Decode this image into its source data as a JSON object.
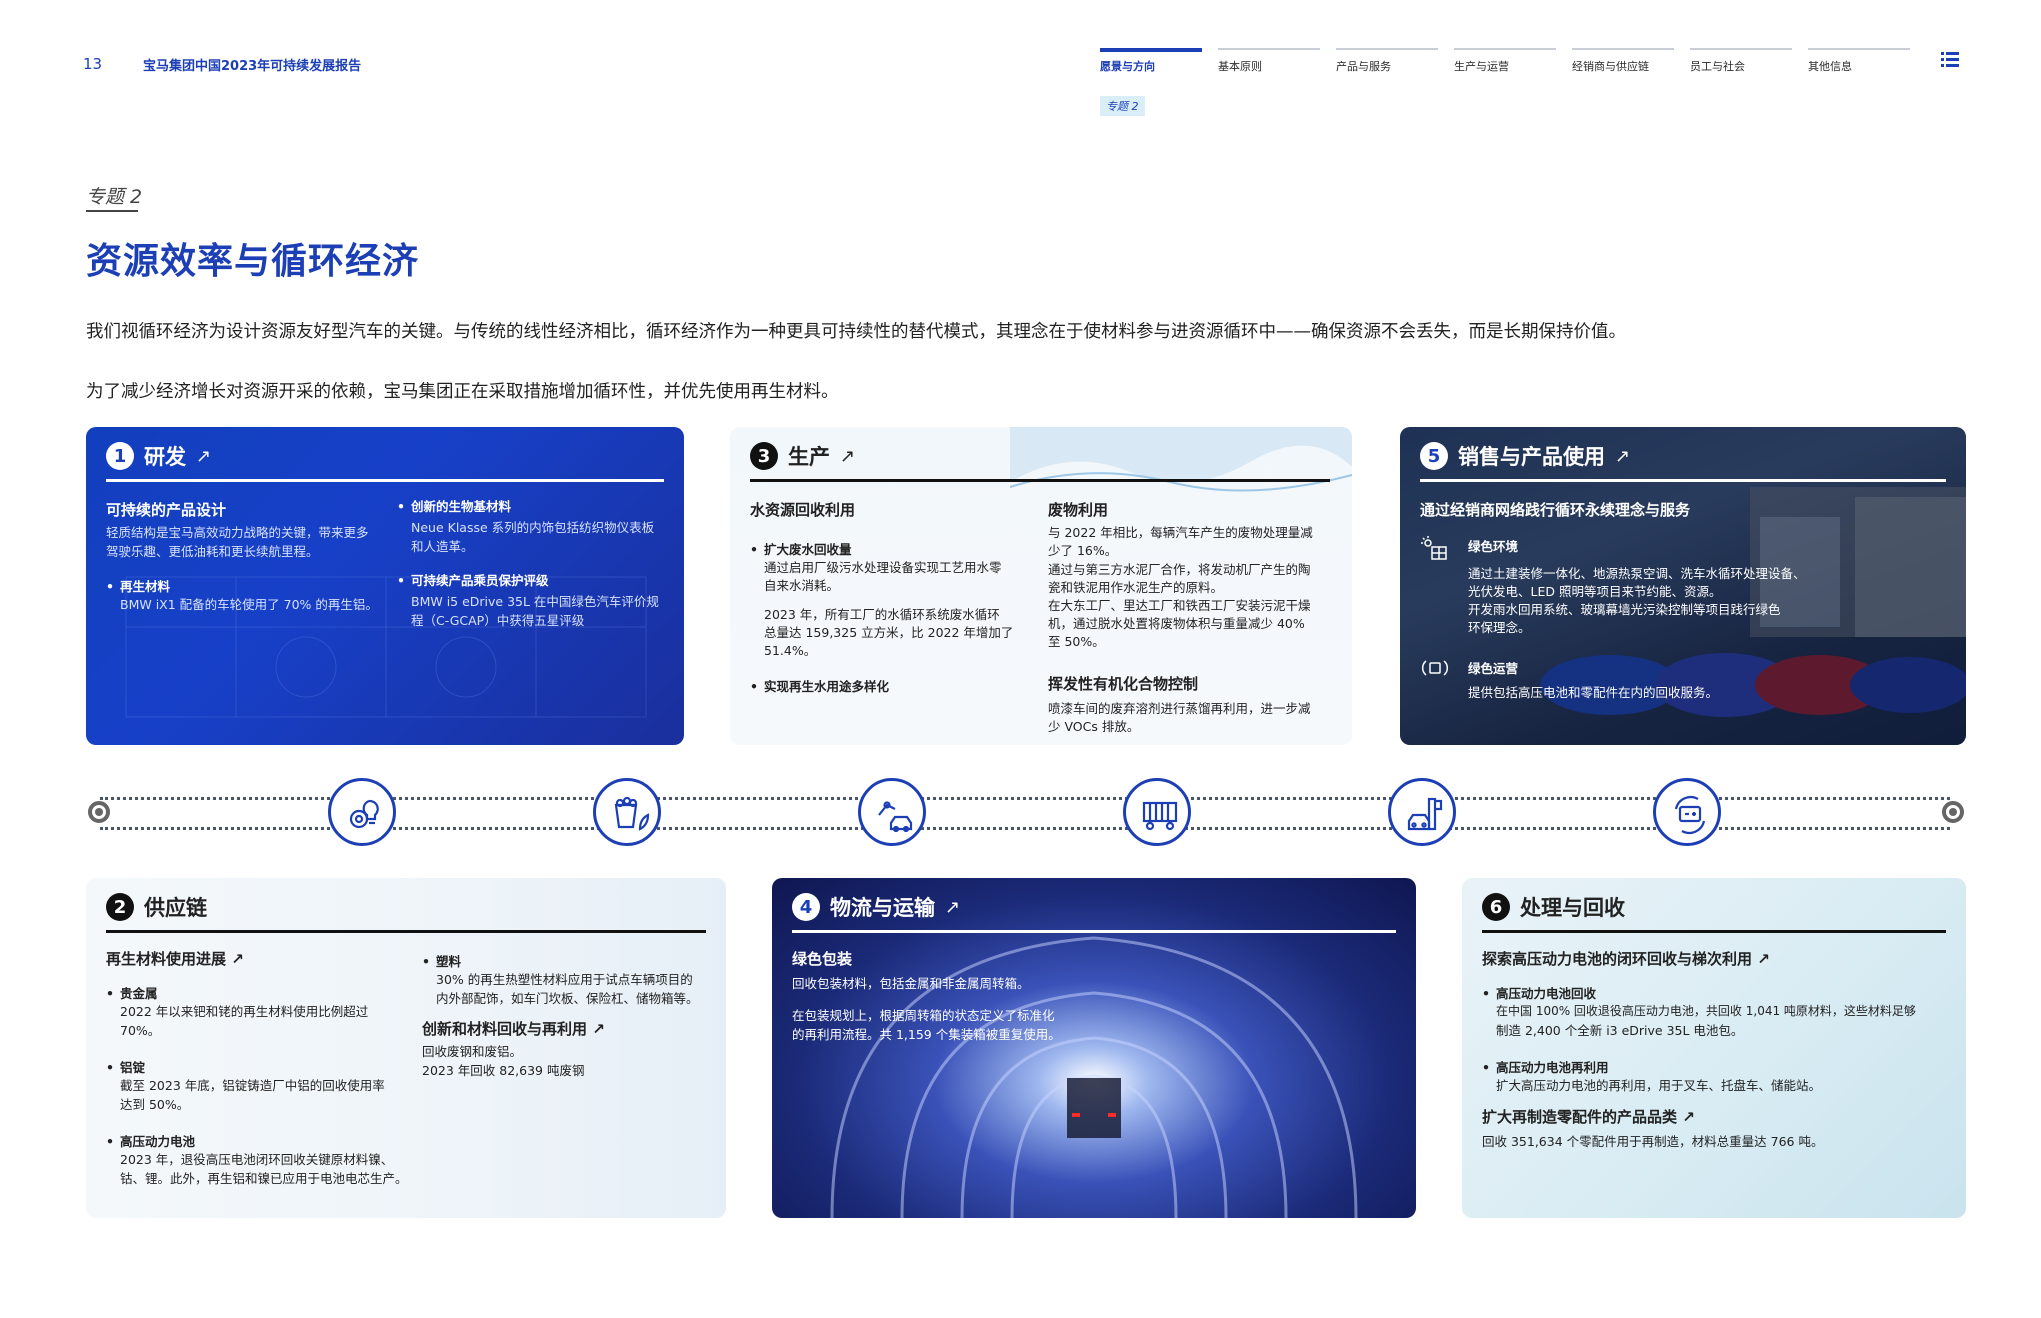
{
  "header": {
    "page_number": "13",
    "doc_title": "宝马集团中国2023年可持续发展报告",
    "nav": [
      "愿景与方向",
      "基本原则",
      "产品与服务",
      "生产与运营",
      "经销商与供应链",
      "员工与社会",
      "其他信息"
    ],
    "nav_sub": "专题 2"
  },
  "intro": {
    "kicker": "专题 2",
    "heading": "资源效率与循环经济",
    "para1": "我们视循环经济为设计资源友好型汽车的关键。与传统的线性经济相比，循环经济作为一种更具可持续性的替代模式，其理念在于使材料参与进资源循环中——确保资源不会丢失，而是长期保持价值。",
    "para2": "为了减少经济增长对资源开采的依赖，宝马集团正在采取措施增加循环性，并优先使用再生材料。"
  },
  "card1": {
    "num": "1",
    "title": "研发",
    "arrow": "↗",
    "sub1": "可持续的产品设计",
    "sub1_text1": "轻质结构是宝马高效动力战略的关键，带来更多",
    "sub1_text2": "驾驶乐趣、更低油耗和更长续航里程。",
    "b1_title": "再生材料",
    "b1_text": "BMW iX1 配备的车轮使用了 70% 的再生铝。",
    "b2_title": "创新的生物基材料",
    "b2_text1": "Neue Klasse 系列的内饰包括纺织物仪表板",
    "b2_text2": "和人造革。",
    "b3_title": "可持续产品乘员保护评级",
    "b3_text1": "BMW i5 eDrive 35L 在中国绿色汽车评价规",
    "b3_text2": "程（C-GCAP）中获得五星评级"
  },
  "card3": {
    "num": "3",
    "title": "生产",
    "arrow": "↗",
    "colA_title": "水资源回收利用",
    "a_b1_title": "扩大废水回收量",
    "a_b1_l1": "通过启用厂级污水处理设备实现工艺用水零",
    "a_b1_l2": "自来水消耗。",
    "a_b1_l3": "2023 年，所有工厂的水循环系统废水循环",
    "a_b1_l4": "总量达 159,325 立方米，比 2022 年增加了",
    "a_b1_l5": "51.4%。",
    "a_b2_title": "实现再生水用途多样化",
    "colB_title": "废物利用",
    "b_l1": "与 2022 年相比，每辆汽车产生的废物处理量减",
    "b_l2": "少了 16%。",
    "b_l3": "通过与第三方水泥厂合作，将发动机厂产生的陶",
    "b_l4": "瓷和铁泥用作水泥生产的原料。",
    "b_l5": "在大东工厂、里达工厂和铁西工厂安装污泥干燥",
    "b_l6": "机，通过脱水处置将废物体积与重量减少 40%",
    "b_l7": "至 50%。",
    "colB2_title": "挥发性有机化合物控制",
    "c_l1": "喷漆车间的废弃溶剂进行蒸馏再利用，进一步减",
    "c_l2": "少 VOCs 排放。"
  },
  "card5": {
    "num": "5",
    "title": "销售与产品使用",
    "arrow": "↗",
    "sub": "通过经销商网络践行循环永续理念与服务",
    "i1_title": "绿色环境",
    "i1_l1": "通过土建装修一体化、地源热泵空调、洗车水循环处理设备、",
    "i1_l2": "光伏发电、LED 照明等项目来节约能、资源。",
    "i1_l3": "开发雨水回用系统、玻璃幕墙光污染控制等项目践行绿色",
    "i1_l4": "环保理念。",
    "i2_title": "绿色运营",
    "i2_l1": "提供包括高压电池和零配件在内的回收服务。"
  },
  "card2": {
    "num": "2",
    "title": "供应链",
    "sub": "再生材料使用进展",
    "sub_arrow": "↗",
    "b1_title": "贵金属",
    "b1_l1": "2022 年以来钯和铑的再生材料使用比例超过",
    "b1_l2": "70%。",
    "b2_title": "铝锭",
    "b2_l1": "截至 2023 年底，铝锭铸造厂中铝的回收使用率",
    "b2_l2": "达到 50%。",
    "b3_title": "高压动力电池",
    "b3_l1": "2023 年，退役高压电池闭环回收关键原材料镍、",
    "b3_l2": "钴、锂。此外，再生铝和镍已应用于电池电芯生产。",
    "b4_title": "塑料",
    "b4_l1": "30% 的再生热塑性材料应用于试点车辆项目的",
    "b4_l2": "内外部配饰，如车门坎板、保险杠、储物箱等。",
    "sub2": "创新和材料回收与再利用",
    "sub2_arrow": "↗",
    "s2_l1": "回收废钢和废铝。",
    "s2_l2": "2023 年回收 82,639 吨废钢"
  },
  "card4": {
    "num": "4",
    "title": "物流与运输",
    "arrow": "↗",
    "sub": "绿色包装",
    "l1": "回收包装材料，包括金属和非金属周转箱。",
    "l2": "在包装规划上，根据周转箱的状态定义了标准化",
    "l3": "的再利用流程。共 1,159 个集装箱被重复使用。"
  },
  "card6": {
    "num": "6",
    "title": "处理与回收",
    "sub": "探索高压动力电池的闭环回收与梯次利用",
    "sub_arrow": "↗",
    "b1_title": "高压动力电池回收",
    "b1_l1": "在中国 100% 回收退役高压动力电池，共回收 1,041 吨原材料，这些材料足够",
    "b1_l2": "制造 2,400 个全新 i3 eDrive 35L 电池包。",
    "b2_title": "高压动力电池再利用",
    "b2_l1": "扩大高压动力电池的再利用，用于叉车、托盘车、储能站。",
    "sub2": "扩大再制造零配件的产品品类",
    "sub2_arrow": "↗",
    "s2_l1": "回收 351,634 个零配件用于再制造，材料总重量达 766 吨。"
  },
  "timeline_icons": [
    "gear-bulb-icon",
    "recycle-bin-leaf-icon",
    "robot-arm-car-icon",
    "freight-train-icon",
    "car-dealer-icon",
    "battery-recycle-icon"
  ],
  "colors": {
    "brand_blue": "#1c3fb5",
    "accent_light": "#d9eef9"
  }
}
